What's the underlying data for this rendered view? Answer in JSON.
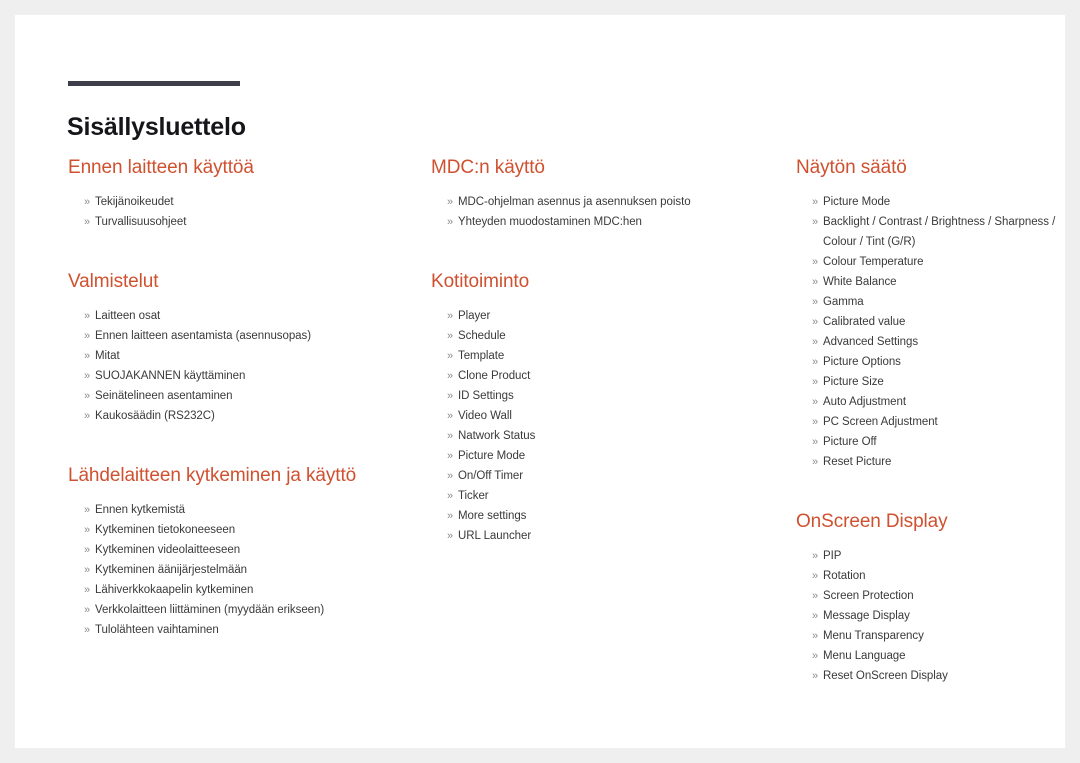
{
  "document": {
    "title": "Sisällysluettelo",
    "bullet_glyph": "»",
    "accent_color": "#cf5130",
    "rule_color": "#3e3d4a",
    "text_color": "#3a3a3a",
    "page_background": "#ffffff",
    "canvas_background": "#efefef"
  },
  "columns": [
    {
      "id": "column-1",
      "sections": [
        {
          "id": "ennen-laitteen-kayttoa",
          "heading": "Ennen laitteen käyttöä",
          "items": [
            "Tekijänoikeudet",
            "Turvallisuusohjeet"
          ]
        },
        {
          "id": "valmistelut",
          "heading": "Valmistelut",
          "items": [
            "Laitteen osat",
            "Ennen laitteen asentamista (asennusopas)",
            "Mitat",
            "SUOJAKANNEN käyttäminen",
            "Seinätelineen asentaminen",
            "Kaukosäädin (RS232C)"
          ]
        },
        {
          "id": "lahdelaitteen-kytkeminen-ja-kaytto",
          "heading": "Lähdelaitteen kytkeminen ja käyttö",
          "items": [
            "Ennen kytkemistä",
            "Kytkeminen tietokoneeseen",
            "Kytkeminen videolaitteeseen",
            "Kytkeminen äänijärjestelmään",
            "Lähiverkkokaapelin kytkeminen",
            "Verkkolaitteen liittäminen (myydään erikseen)",
            "Tulolähteen vaihtaminen"
          ]
        }
      ]
    },
    {
      "id": "column-2",
      "sections": [
        {
          "id": "mdcn-kaytto",
          "heading": "MDC:n käyttö",
          "items": [
            "MDC-ohjelman asennus ja asennuksen poisto",
            "Yhteyden muodostaminen MDC:hen"
          ]
        },
        {
          "id": "kotitoiminto",
          "heading": "Kotitoiminto",
          "items": [
            "Player",
            "Schedule",
            "Template",
            "Clone Product",
            "ID Settings",
            "Video Wall",
            "Natwork Status",
            "Picture Mode",
            "On/Off Timer",
            "Ticker",
            "More settings",
            "URL Launcher"
          ]
        }
      ]
    },
    {
      "id": "column-3",
      "sections": [
        {
          "id": "nayton-saato",
          "heading": "Näytön säätö",
          "items": [
            "Picture Mode",
            "Backlight / Contrast / Brightness / Sharpness / Colour / Tint (G/R)",
            "Colour Temperature",
            "White Balance",
            "Gamma",
            "Calibrated value",
            "Advanced Settings",
            "Picture Options",
            "Picture Size",
            "Auto Adjustment",
            "PC Screen Adjustment",
            "Picture Off",
            "Reset Picture"
          ]
        },
        {
          "id": "onscreen-display",
          "heading": "OnScreen Display",
          "items": [
            "PIP",
            "Rotation",
            "Screen Protection",
            "Message Display",
            "Menu Transparency",
            "Menu Language",
            "Reset OnScreen Display"
          ]
        }
      ]
    }
  ]
}
